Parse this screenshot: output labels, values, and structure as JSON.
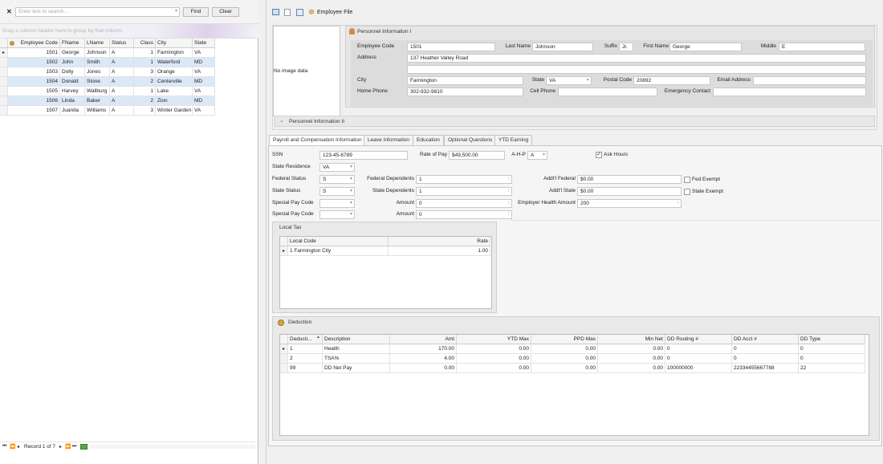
{
  "search": {
    "close": "✕",
    "placeholder": "Enter text to search...",
    "find": "Find",
    "clear": "Clear"
  },
  "group_hint": "Drag a column header here to group by that column",
  "left_grid": {
    "columns": [
      "Employee Code",
      "FName",
      "LName",
      "Status",
      "Class",
      "City",
      "State"
    ],
    "rows": [
      [
        "1501",
        "George",
        "Johnson",
        "A",
        "1",
        "Farmington",
        "VA"
      ],
      [
        "1502",
        "John",
        "Smith",
        "A",
        "1",
        "Waterford",
        "MD"
      ],
      [
        "1503",
        "Dolly",
        "Jones",
        "A",
        "3",
        "Orange",
        "VA"
      ],
      [
        "1504",
        "Donald",
        "Stone",
        "A",
        "2",
        "Centerville",
        "MD"
      ],
      [
        "1505",
        "Harvey",
        "Wallburg",
        "A",
        "1",
        "Lake",
        "VA"
      ],
      [
        "1506",
        "Linda",
        "Baker",
        "A",
        "2",
        "Zion",
        "MD"
      ],
      [
        "1507",
        "Juanita",
        "Williams",
        "A",
        "3",
        "Winter Garden",
        "VA"
      ]
    ]
  },
  "nav": {
    "record": "Record 1 of 7"
  },
  "toolbar": {
    "title": "Employee File"
  },
  "personnel": {
    "header": "Personnel Information I",
    "no_image": "No image data",
    "labels": {
      "employee_code": "Employee Code",
      "last_name": "Last Name",
      "suffix": "Suffix",
      "first_name": "First Name",
      "middle": "Middle",
      "address": "Address",
      "city": "City",
      "state": "State",
      "postal": "Postal Code",
      "email": "Email Address",
      "home_phone": "Home Phone",
      "cell_phone": "Cell Phone",
      "emergency": "Emergency Contact"
    },
    "values": {
      "employee_code": "1501",
      "last_name": "Johnson",
      "suffix": "Jr.",
      "first_name": "George",
      "middle": "E",
      "address1": "137 Heather Valley Road",
      "address2": "",
      "city": "Farmington",
      "state": "VA",
      "postal": "20892",
      "email": "",
      "home_phone": "302-932-9810",
      "cell_phone": "",
      "emergency": ""
    },
    "header2": "Personnel Information II"
  },
  "tabs": [
    "Payroll and Compensation Information",
    "Leave Information",
    "Education",
    "Optional Questions",
    "YTD Earning"
  ],
  "payroll": {
    "labels": {
      "ssn": "SSN",
      "rate": "Rate of Pay",
      "ahp": "A-H-P",
      "ask_hours": "Ask Hours",
      "state_res": "State Residence",
      "fed_status": "Federal Status",
      "fed_dep": "Federal  Dependents",
      "addl_fed": "Addt'l Federal",
      "fed_exempt": "Fed Exempt",
      "state_status": "State Status",
      "state_dep": "State Dependents",
      "addl_state": "Addt'l State",
      "state_exempt": "State Exempt",
      "spc1": "Special Pay Code",
      "amt1": "Amount",
      "emp_health": "Employer Health Amount",
      "spc2": "Special Pay Code",
      "amt2": "Amount"
    },
    "values": {
      "ssn": "123-45-6789",
      "rate": "$49,500.00",
      "ahp": "A",
      "state_res": "VA",
      "fed_status": "S",
      "fed_dep": "1",
      "addl_fed": "$0.00",
      "state_status": "S",
      "state_dep": "1",
      "addl_state": "$0.00",
      "spc1": "",
      "amt1": "0",
      "emp_health": "200",
      "spc2": "",
      "amt2": "0"
    },
    "checks": {
      "ask_hours": "✓"
    }
  },
  "local_tax": {
    "title": "Local Tax",
    "columns": [
      "Local Code",
      "Rate"
    ],
    "rows": [
      [
        "1 Farmington City",
        "1.00"
      ]
    ]
  },
  "deduction": {
    "title": "Deduction",
    "columns": [
      "Deducti...",
      "Description",
      "Amt",
      "YTD Max",
      "PPD Max",
      "Min Net",
      "DD Routing #",
      "DD Acct #",
      "DD Type"
    ],
    "rows": [
      [
        "1",
        "Health",
        "170.00",
        "0.00",
        "0.00",
        "0.00",
        "0",
        "0",
        "0"
      ],
      [
        "2",
        "TSA%",
        "4.00",
        "0.00",
        "0.00",
        "0.00",
        "0",
        "0",
        "0"
      ],
      [
        "99",
        "DD Net Pay",
        "0.00",
        "0.00",
        "0.00",
        "0.00",
        "100000000",
        "22334455667788",
        "22"
      ]
    ]
  },
  "colors": {
    "accent": "#6b3fa0",
    "selection": "#dbe8f7",
    "panel": "#f0f0f0"
  }
}
